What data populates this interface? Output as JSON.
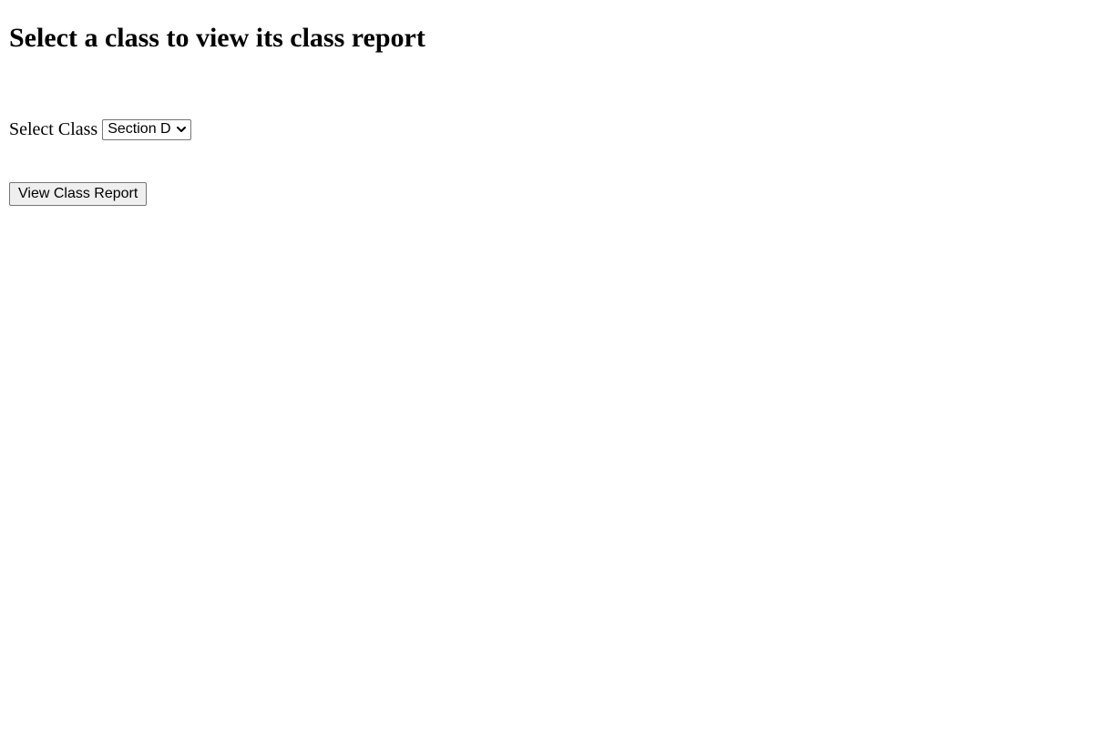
{
  "page": {
    "title": "Select a class to view its class report"
  },
  "class_select": {
    "label": "Select Class",
    "selected_value": "Section D"
  },
  "actions": {
    "view_report_label": "View Class Report"
  }
}
